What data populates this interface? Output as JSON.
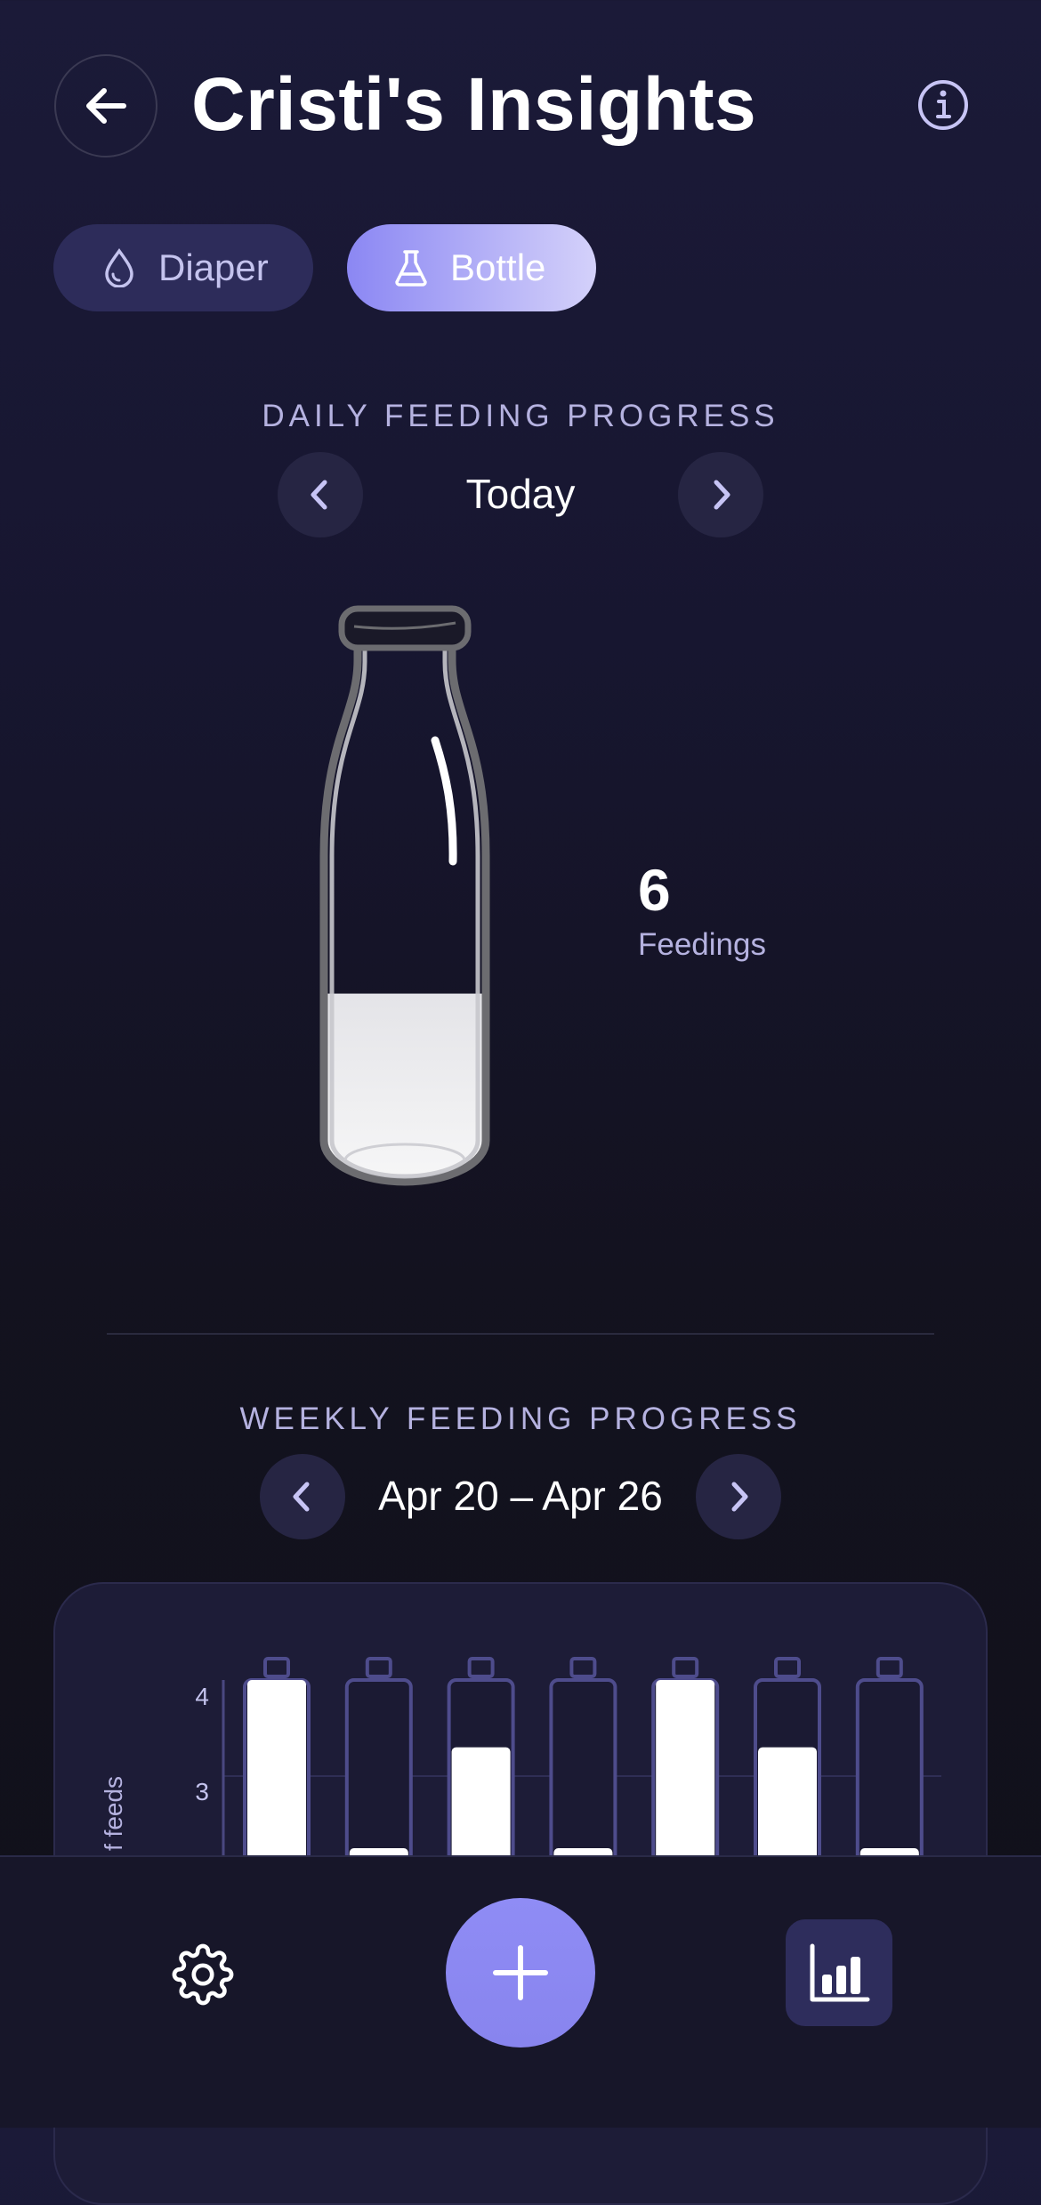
{
  "header": {
    "title": "Cristi's Insights",
    "back_icon": "arrow-left-icon",
    "info_icon": "info-icon"
  },
  "tabs": [
    {
      "label": "Diaper",
      "icon": "droplet-icon",
      "selected": false
    },
    {
      "label": "Bottle",
      "icon": "flask-icon",
      "selected": true
    }
  ],
  "daily": {
    "section_label": "DAILY FEEDING PROGRESS",
    "period": "Today",
    "feed_count": "6",
    "feed_count_label": "Feedings",
    "bottle_fill": 0.35
  },
  "weekly": {
    "section_label": "WEEKLY FEEDING PROGRESS",
    "period": "Apr 20 – Apr 26"
  },
  "chart_data": {
    "type": "bar",
    "ylabel_visible": "f feeds",
    "yticks": [
      "4",
      "3"
    ],
    "categories": [],
    "values": [
      4.0,
      2.25,
      3.3,
      2.25,
      4.0,
      3.3,
      2.25
    ],
    "ylim_visible": [
      2.0,
      4.0
    ],
    "grid": true
  },
  "bottom_nav": {
    "settings_icon": "gear-icon",
    "add_icon": "plus-icon",
    "stats_icon": "bar-chart-icon"
  },
  "colors": {
    "accent": "#8b87f3",
    "tab_inactive_bg": "#2d2c5a",
    "label": "#b5b2e0"
  }
}
